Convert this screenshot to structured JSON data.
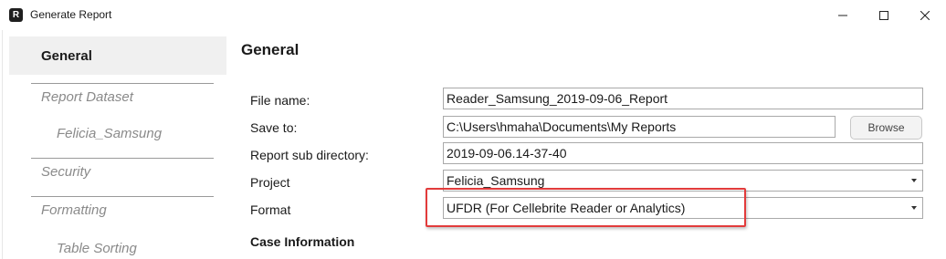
{
  "window": {
    "title": "Generate Report",
    "app_icon_letter": "R"
  },
  "sidebar": {
    "items": [
      {
        "label": "General",
        "active": true
      },
      {
        "label": "Report Dataset"
      },
      {
        "label": "Felicia_Samsung"
      },
      {
        "label": "Security"
      },
      {
        "label": "Formatting"
      },
      {
        "label": "Table Sorting"
      }
    ]
  },
  "main": {
    "heading": "General",
    "fields": {
      "file_name": {
        "label": "File name:",
        "value": "Reader_Samsung_2019-09-06_Report"
      },
      "save_to": {
        "label": "Save to:",
        "value": "C:\\Users\\hmaha\\Documents\\My Reports",
        "browse_label": "Browse"
      },
      "sub_directory": {
        "label": "Report sub directory:",
        "value": "2019-09-06.14-37-40"
      },
      "project": {
        "label": "Project",
        "value": "Felicia_Samsung"
      },
      "format": {
        "label": "Format",
        "value": "UFDR (For Cellebrite Reader or Analytics)"
      }
    },
    "case_information": "Case Information"
  },
  "colors": {
    "highlight": "#e23b3b",
    "active_nav_bg": "#f0f0f0",
    "dim_nav_text": "#8a8a8a"
  }
}
